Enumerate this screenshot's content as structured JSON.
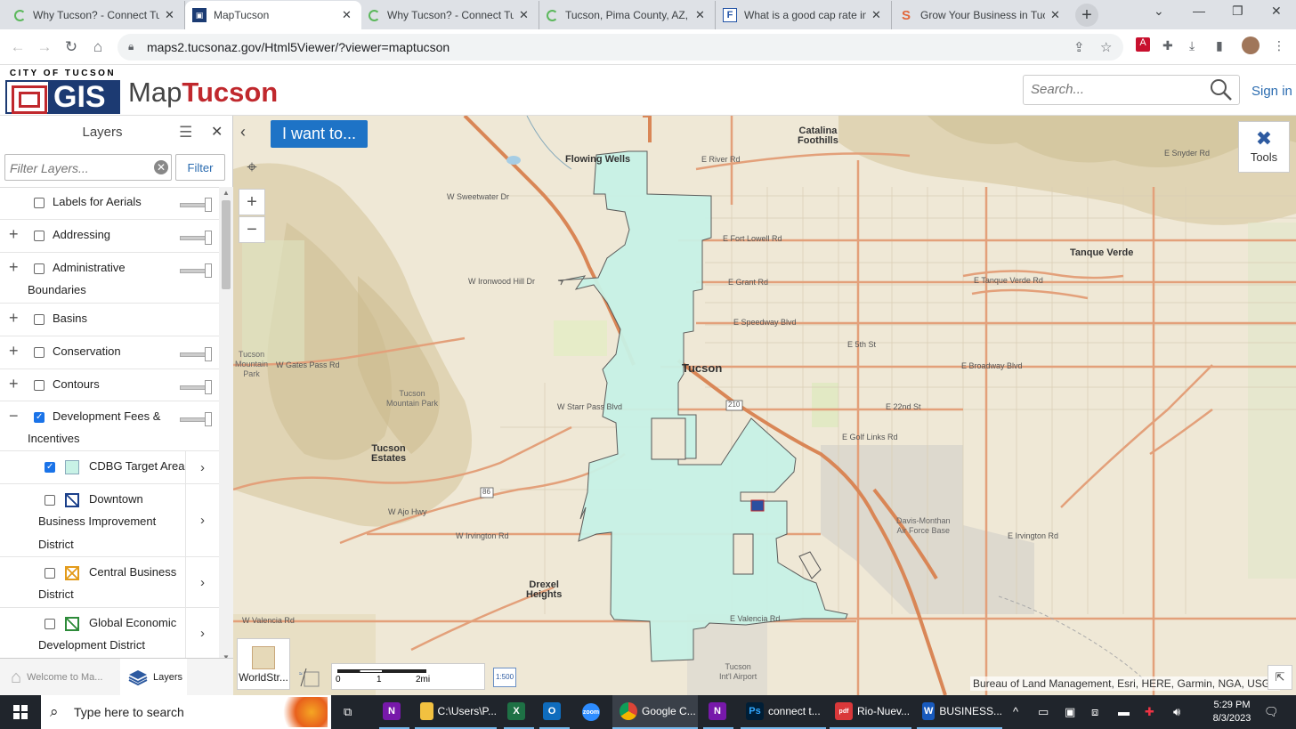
{
  "browser": {
    "tabs": [
      {
        "title": "Why Tucson? - Connect Tuc",
        "favicon": "C",
        "active": false
      },
      {
        "title": "MapTucson",
        "favicon": "map",
        "active": true
      },
      {
        "title": "Why Tucson? - Connect Tuc",
        "favicon": "C",
        "active": false
      },
      {
        "title": "Tucson, Pima County, AZ, U",
        "favicon": "C",
        "active": false
      },
      {
        "title": "What is a good cap rate in",
        "favicon": "F",
        "active": false
      },
      {
        "title": "Grow Your Business in Tucs",
        "favicon": "S",
        "active": false
      }
    ],
    "url": "maps2.tucsonaz.gov/Html5Viewer/?viewer=maptucson"
  },
  "header": {
    "city_text": "CITY OF TUCSON",
    "gis_text": "GIS",
    "app_name_prefix": "Map",
    "app_name_suffix": "Tucson",
    "search_placeholder": "Search...",
    "signin_label": "Sign in"
  },
  "panel": {
    "title": "Layers",
    "filter_placeholder": "Filter Layers...",
    "filter_button": "Filter",
    "layers": [
      {
        "name": "Labels for Aerials",
        "expand": "",
        "checked": false,
        "slider": true
      },
      {
        "name": "Addressing",
        "expand": "+",
        "checked": false,
        "slider": true
      },
      {
        "name": "Administrative",
        "name2": "Boundaries",
        "expand": "+",
        "checked": false,
        "slider": true
      },
      {
        "name": "Basins",
        "expand": "+",
        "checked": false,
        "slider": false
      },
      {
        "name": "Conservation",
        "expand": "+",
        "checked": false,
        "slider": true
      },
      {
        "name": "Contours",
        "expand": "+",
        "checked": false,
        "slider": true
      },
      {
        "name": "Development Fees &",
        "name2": "Incentives",
        "expand": "−",
        "checked": true,
        "slider": true
      }
    ],
    "sublayers": [
      {
        "name": "CDBG Target Area",
        "checked": true
      },
      {
        "name": "Downtown",
        "name2": "Business Improvement",
        "name3": "District",
        "checked": false
      },
      {
        "name": "Central Business",
        "name2": "District",
        "checked": false
      },
      {
        "name": "Global Economic",
        "name2": "Development District",
        "checked": false
      }
    ],
    "bottom_tabs": [
      {
        "label": "Welcome to Ma...",
        "active": false
      },
      {
        "label": "Layers",
        "active": true
      }
    ]
  },
  "map": {
    "i_want_to": "I want to...",
    "tools_label": "Tools",
    "basemap_label": "WorldStr...",
    "scale": {
      "ticks": [
        "0",
        "1",
        "2mi"
      ],
      "ratio": "1:500"
    },
    "attribution": "Bureau of Land Management, Esri, HERE, Garmin, NGA, USGS",
    "places": [
      {
        "name": "Catalina\nFoothills"
      },
      {
        "name": "Flowing Wells"
      },
      {
        "name": "Tanque Verde"
      },
      {
        "name": "Tucson\nEstates"
      },
      {
        "name": "Drexel\nHeights"
      },
      {
        "name": "Tucson"
      },
      {
        "name": "Tucson\nMountain\nPark"
      },
      {
        "name": "Tucson\nMountain Park"
      },
      {
        "name": "Davis-Monthan\nAir Force Base"
      },
      {
        "name": "Tucson\nInt'l Airport"
      }
    ],
    "streets": [
      "E River Rd",
      "E Fort Lowell Rd",
      "E Grant Rd",
      "E Speedway Blvd",
      "E Broadway Blvd",
      "E 22nd St",
      "E Golf Links Rd",
      "E Irvington Rd",
      "W Valencia Rd",
      "W Ajo Hwy",
      "W Gates Pass Rd",
      "W Starr Pass Blvd",
      "W Ironwood Hill Dr",
      "W Sweetwater Dr",
      "E Tanque Verde Rd",
      "E Snyder Rd",
      "W Irvington Rd",
      "E Valencia Rd",
      "E 5th St"
    ],
    "colors": {
      "cdbg_fill": "#c8f2e6",
      "cdbg_stroke": "#555555",
      "road": "#e39a72",
      "terrain": "#e8dfc4"
    }
  },
  "taskbar": {
    "search_text": "Type here to search",
    "items": [
      {
        "label": "",
        "icon": "N",
        "color": "#7719aa"
      },
      {
        "label": "C:\\Users\\P...",
        "icon": "folder",
        "color": "#f2c140"
      },
      {
        "label": "",
        "icon": "X",
        "color": "#1e7145"
      },
      {
        "label": "",
        "icon": "O",
        "color": "#0f6cbd"
      },
      {
        "label": "",
        "icon": "zoom",
        "color": "#2d8cff"
      },
      {
        "label": "Google C...",
        "icon": "chrome",
        "color": "#4285f4"
      },
      {
        "label": "",
        "icon": "N",
        "color": "#7719aa"
      },
      {
        "label": "connect t...",
        "icon": "Ps",
        "color": "#001e36"
      },
      {
        "label": "Rio-Nuev...",
        "icon": "pdf",
        "color": "#d9383a"
      },
      {
        "label": "BUSINESS...",
        "icon": "W",
        "color": "#185abd"
      }
    ],
    "time": "5:29 PM",
    "date": "8/3/2023"
  }
}
